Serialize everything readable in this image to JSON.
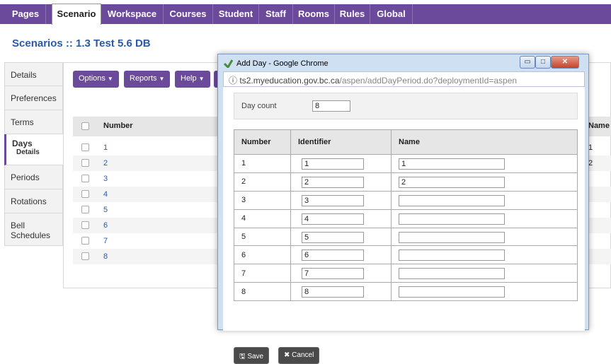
{
  "nav": {
    "tabs": [
      {
        "label": "Pages"
      },
      {
        "label": "Scenario"
      },
      {
        "label": "Workspace"
      },
      {
        "label": "Courses"
      },
      {
        "label": "Student"
      },
      {
        "label": "Staff"
      },
      {
        "label": "Rooms"
      },
      {
        "label": "Rules"
      },
      {
        "label": "Global"
      }
    ],
    "active_tab": "Scenario"
  },
  "page": {
    "title": "Scenarios :: 1.3 Test 5.6 DB"
  },
  "sidebar": {
    "items": [
      {
        "label": "Details"
      },
      {
        "label": "Preferences"
      },
      {
        "label": "Terms"
      },
      {
        "label": "Days",
        "sub": "Details"
      },
      {
        "label": "Periods"
      },
      {
        "label": "Rotations"
      },
      {
        "label": "Bell Schedules"
      }
    ]
  },
  "toolbar": {
    "options": "Options",
    "reports": "Reports",
    "help": "Help"
  },
  "grid": {
    "headers": {
      "number": "Number",
      "name": "Name"
    },
    "rows": [
      {
        "number": "1",
        "name": "1"
      },
      {
        "number": "2",
        "name": "2"
      },
      {
        "number": "3",
        "name": ""
      },
      {
        "number": "4",
        "name": ""
      },
      {
        "number": "5",
        "name": ""
      },
      {
        "number": "6",
        "name": ""
      },
      {
        "number": "7",
        "name": ""
      },
      {
        "number": "8",
        "name": ""
      }
    ]
  },
  "dialog": {
    "title": "Add Day - Google Chrome",
    "url_host": "ts2.myeducation.gov.bc.ca",
    "url_path": "/aspen/addDayPeriod.do?deploymentId=aspen",
    "day_count_label": "Day count",
    "day_count_value": "8",
    "headers": {
      "number": "Number",
      "identifier": "Identifier",
      "name": "Name"
    },
    "rows": [
      {
        "number": "1",
        "identifier": "1",
        "name": "1"
      },
      {
        "number": "2",
        "identifier": "2",
        "name": "2"
      },
      {
        "number": "3",
        "identifier": "3",
        "name": ""
      },
      {
        "number": "4",
        "identifier": "4",
        "name": ""
      },
      {
        "number": "5",
        "identifier": "5",
        "name": ""
      },
      {
        "number": "6",
        "identifier": "6",
        "name": ""
      },
      {
        "number": "7",
        "identifier": "7",
        "name": ""
      },
      {
        "number": "8",
        "identifier": "8",
        "name": ""
      }
    ],
    "save_label": "Save",
    "cancel_label": "Cancel",
    "icons": {
      "save": "save-icon",
      "cancel": "cancel-icon",
      "info": "info-icon",
      "app": "chrome-app-icon"
    }
  },
  "colors": {
    "brand": "#6b4a9b",
    "link": "#2a5aa8"
  }
}
